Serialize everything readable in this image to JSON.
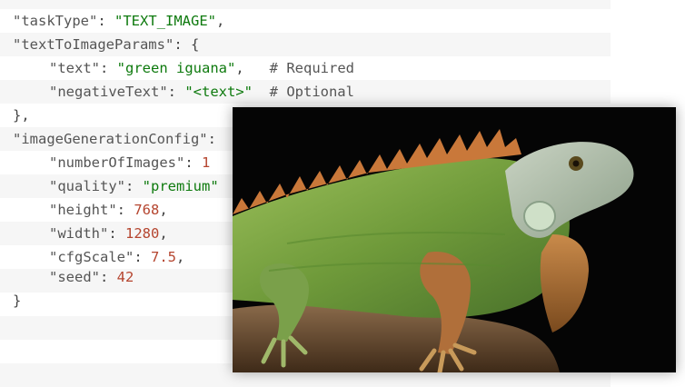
{
  "code": {
    "lines": {
      "l1": {
        "key": "\"taskType\"",
        "sep": ": ",
        "value": "\"TEXT_IMAGE\"",
        "tail": ","
      },
      "l2": {
        "key": "\"textToImageParams\"",
        "sep": ": ",
        "value": "{",
        "tail": ""
      },
      "l3": {
        "key": "\"text\"",
        "sep": ": ",
        "value": "\"green iguana\"",
        "tail": ",",
        "comment": "# Required"
      },
      "l4": {
        "key": "\"negativeText\"",
        "sep": ": ",
        "value": "\"<text>\"",
        "tail": "",
        "comment": "# Optional"
      },
      "l5": {
        "text": "},"
      },
      "l6": {
        "key": "\"imageGenerationConfig\"",
        "sep": ":",
        "value": "",
        "tail": ""
      },
      "l7": {
        "key": "\"numberOfImages\"",
        "sep": ": ",
        "value": "1",
        "tail": ""
      },
      "l8": {
        "key": "\"quality\"",
        "sep": ": ",
        "value": "\"premium\"",
        "tail": ""
      },
      "l9": {
        "key": "\"height\"",
        "sep": ": ",
        "value": "768",
        "tail": ","
      },
      "l10": {
        "key": "\"width\"",
        "sep": ": ",
        "value": "1280",
        "tail": ","
      },
      "l11": {
        "key": "\"cfgScale\"",
        "sep": ": ",
        "value": "7.5",
        "tail": ","
      },
      "l12": {
        "key": "\"seed\"",
        "sep": ": ",
        "value": "42",
        "tail": ""
      },
      "l13": {
        "text": "}"
      }
    }
  },
  "colors": {
    "string": "#0e7a0e",
    "number": "#b5452f",
    "key": "#555555",
    "stripe": "#f6f6f6"
  },
  "image": {
    "subject": "iguana-photo",
    "background": "#050505"
  }
}
